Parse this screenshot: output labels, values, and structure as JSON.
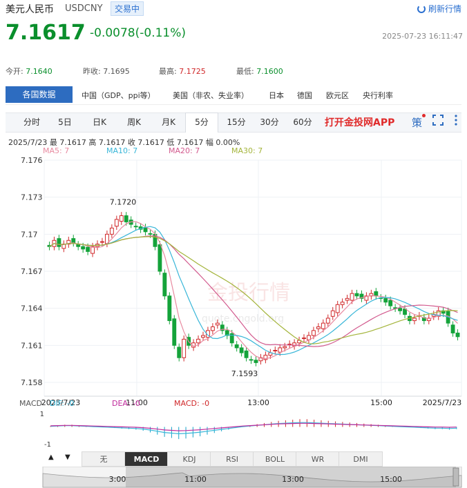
{
  "header": {
    "title": "美元人民币",
    "code": "USDCNY",
    "badge": "交易中",
    "refresh": "刷新行情",
    "price": "7.1617",
    "change": "-0.0078(-0.11%)",
    "datetime": "2025-07-23 16:11:47"
  },
  "stats": [
    {
      "label": "今开:",
      "value": "7.1640",
      "tone": "down"
    },
    {
      "label": "昨收:",
      "value": "7.1695",
      "tone": "plain"
    },
    {
      "label": "最高:",
      "value": "7.1725",
      "tone": "up"
    },
    {
      "label": "最低:",
      "value": "7.1600",
      "tone": "down"
    }
  ],
  "nav": {
    "active": "各国数据",
    "items": [
      "中国（GDP、ppi等）",
      "美国（非农、失业率）",
      "日本",
      "德国",
      "欧元区",
      "央行利率"
    ]
  },
  "tabs": [
    "分时",
    "5日",
    "日K",
    "周K",
    "月K",
    "5分",
    "15分",
    "30分",
    "60分"
  ],
  "active_tab": "5分",
  "app_link": "打开金投网APP",
  "tool_icons": [
    "strategy-icon",
    "fullscreen-icon",
    "more-icon"
  ],
  "tool_glyph": "策",
  "info_line": "2025/7/23 最 7.1617 高 7.1617 收 7.1617 低 7.1617 幅 0.00%",
  "ma_legend": [
    {
      "label": "MA5: 7",
      "color": "#e88aa0"
    },
    {
      "label": "MA10: 7",
      "color": "#38b6d8"
    },
    {
      "label": "MA20: 7",
      "color": "#d25a8e"
    },
    {
      "label": "MA30: 7",
      "color": "#a3b43a"
    }
  ],
  "watermark": "金投行情",
  "watermark_url": "quote.cngold.org",
  "macd_legend": {
    "title": "MACD",
    "dif": "DIF: -0",
    "dea": "DEA: -0",
    "macd": "MACD: -0"
  },
  "bottom_tabs": [
    "无",
    "MACD",
    "KDJ",
    "RSI",
    "BOLL",
    "WR",
    "DMI"
  ],
  "bottom_active": "MACD",
  "nav_arrows": [
    "▲",
    "▼"
  ],
  "chart_data": {
    "type": "candlestick",
    "title": "",
    "y_ticks": [
      "7.176",
      "7.173",
      "7.17",
      "7.167",
      "7.164",
      "7.161",
      "7.158"
    ],
    "ylim": [
      7.158,
      7.176
    ],
    "x_labels": [
      "2025/7/23",
      "11:00",
      "13:00",
      "15:00",
      "2025/7/23"
    ],
    "annotations": {
      "high": "7.1720",
      "low": "7.1593"
    },
    "macd_y_ticks": [
      "1",
      "-1"
    ],
    "navigator_labels": [
      "3:00",
      "11:00",
      "13:00",
      "15:00"
    ],
    "closes": [
      7.169,
      7.1695,
      7.169,
      7.1692,
      7.1695,
      7.1693,
      7.169,
      7.1688,
      7.1686,
      7.169,
      7.1692,
      7.1694,
      7.17,
      7.1705,
      7.1712,
      7.1715,
      7.171,
      7.1708,
      7.1706,
      7.1704,
      7.1702,
      7.17,
      7.169,
      7.167,
      7.165,
      7.163,
      7.161,
      7.16,
      7.1615,
      7.161,
      7.1612,
      7.1615,
      7.1618,
      7.1622,
      7.1625,
      7.1628,
      7.1622,
      7.1618,
      7.1612,
      7.1608,
      7.1604,
      7.16,
      7.1598,
      7.1596,
      7.16,
      7.1602,
      7.1604,
      7.1606,
      7.1608,
      7.1609,
      7.1611,
      7.1612,
      7.1614,
      7.1616,
      7.1618,
      7.1622,
      7.1625,
      7.1628,
      7.1632,
      7.1638,
      7.1643,
      7.1645,
      7.1648,
      7.1652,
      7.165,
      7.1648,
      7.165,
      7.1652,
      7.165,
      7.1648,
      7.1645,
      7.1642,
      7.164,
      7.1638,
      7.1635,
      7.163,
      7.1632,
      7.1634,
      7.163,
      7.1632,
      7.1635,
      7.1638,
      7.1636,
      7.1628,
      7.162,
      7.1617
    ],
    "macd_hist": [
      0.1,
      0.15,
      0.2,
      0.2,
      0.15,
      0.1,
      0.05,
      0,
      -0.05,
      -0.1,
      -0.15,
      -0.2,
      -0.25,
      -0.35,
      -0.5,
      -0.7,
      -0.9,
      -1.0,
      -1.1,
      -1.05,
      -0.95,
      -0.85,
      -0.7,
      -0.55,
      -0.4,
      -0.25,
      -0.1,
      0.05,
      0.15,
      0.25,
      0.35,
      0.45,
      0.55,
      0.6,
      0.65,
      0.7,
      0.7,
      0.65,
      0.6,
      0.55,
      0.5,
      0.45,
      0.4,
      0.35,
      0.3,
      0.25,
      0.2,
      0.15,
      0.1,
      0.05,
      0,
      -0.05,
      -0.1,
      -0.15,
      -0.2,
      -0.2,
      -0.25,
      -0.2
    ]
  }
}
